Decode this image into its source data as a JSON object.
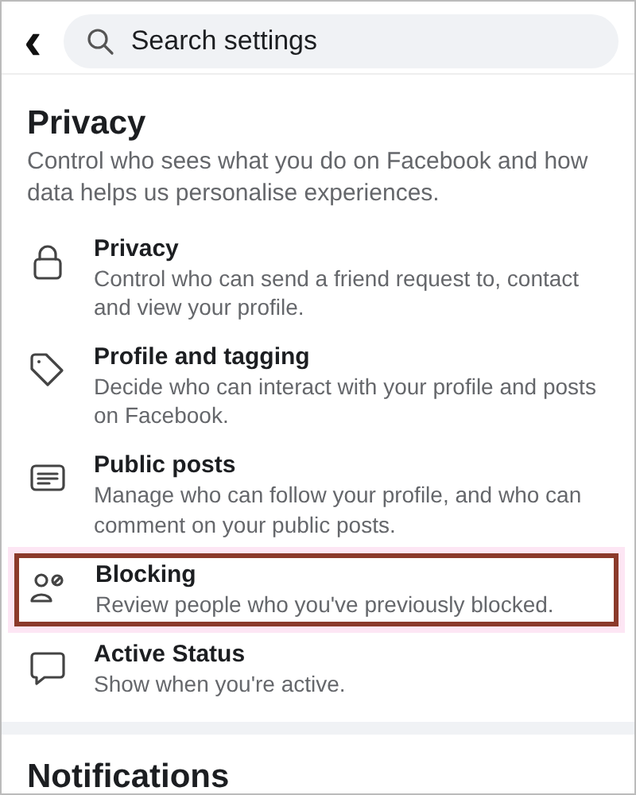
{
  "header": {
    "back_icon": "‹",
    "search": {
      "placeholder": "Search settings"
    }
  },
  "section": {
    "title": "Privacy",
    "description": "Control who sees what you do on Facebook and how data helps us personalise experiences.",
    "items": [
      {
        "title": "Privacy",
        "description": "Control who can send a friend request to, contact and view your profile.",
        "highlighted": false
      },
      {
        "title": "Profile and tagging",
        "description": "Decide who can interact with your profile and posts on Facebook.",
        "highlighted": false
      },
      {
        "title": "Public posts",
        "description": "Manage who can follow your profile, and who can comment on your public posts.",
        "highlighted": false
      },
      {
        "title": "Blocking",
        "description": "Review people who you've previously blocked.",
        "highlighted": true
      },
      {
        "title": "Active Status",
        "description": "Show when you're active.",
        "highlighted": false
      }
    ]
  },
  "next_section": {
    "title": "Notifications"
  }
}
